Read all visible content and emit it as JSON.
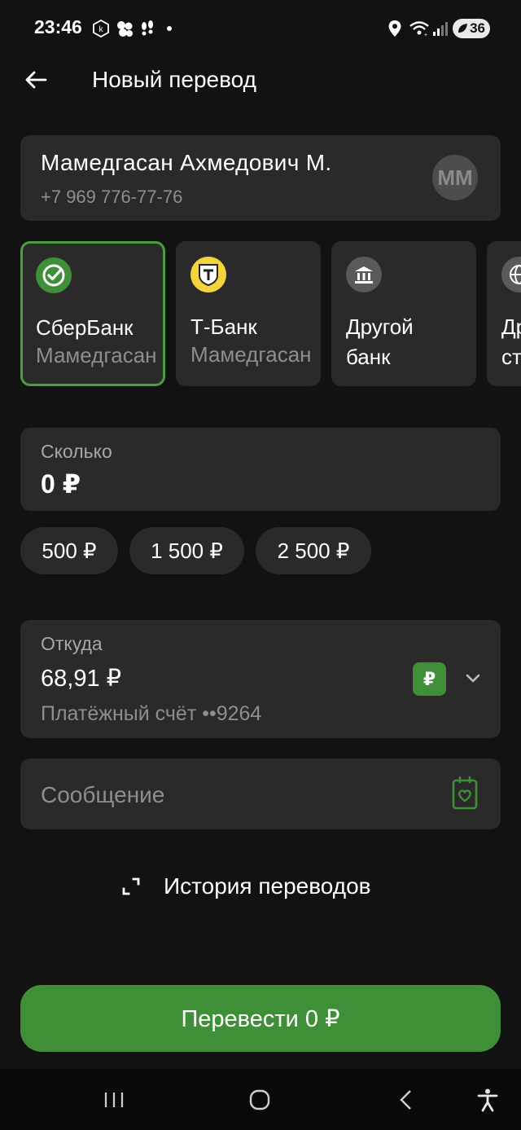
{
  "status_bar": {
    "time": "23:46",
    "battery": "36"
  },
  "header": {
    "title": "Новый перевод"
  },
  "recipient": {
    "name": "Мамедгасан Ахмедович М.",
    "phone": "+7 969 776-77-76",
    "initials": "ММ"
  },
  "banks": [
    {
      "name": "СберБанк",
      "subtitle": "Мамедгасан",
      "icon": "sberbank-icon",
      "selected": true
    },
    {
      "name": "Т-Банк",
      "subtitle": "Мамедгасан",
      "icon": "tbank-icon",
      "selected": false
    },
    {
      "name": "Другой",
      "subtitle": "банк",
      "icon": "bank-building-icon",
      "selected": false
    },
    {
      "name": "Др",
      "subtitle": "ст",
      "icon": "globe-icon",
      "selected": false
    }
  ],
  "amount": {
    "label": "Сколько",
    "value": "0 ₽"
  },
  "quick_amounts": [
    "500 ₽",
    "1 500 ₽",
    "2 500 ₽"
  ],
  "from_account": {
    "label": "Откуда",
    "balance": "68,91 ₽",
    "account": "Платёжный счёт ••9264",
    "currency_badge": "₽"
  },
  "message": {
    "placeholder": "Сообщение"
  },
  "history": {
    "label": "История переводов"
  },
  "submit": {
    "label": "Перевести 0 ₽"
  },
  "colors": {
    "background": "#121212",
    "card": "#2a2a2a",
    "accent_green": "#3f8f38",
    "selected_border": "#4a9e3d",
    "secondary_text": "#8e8e8e"
  }
}
